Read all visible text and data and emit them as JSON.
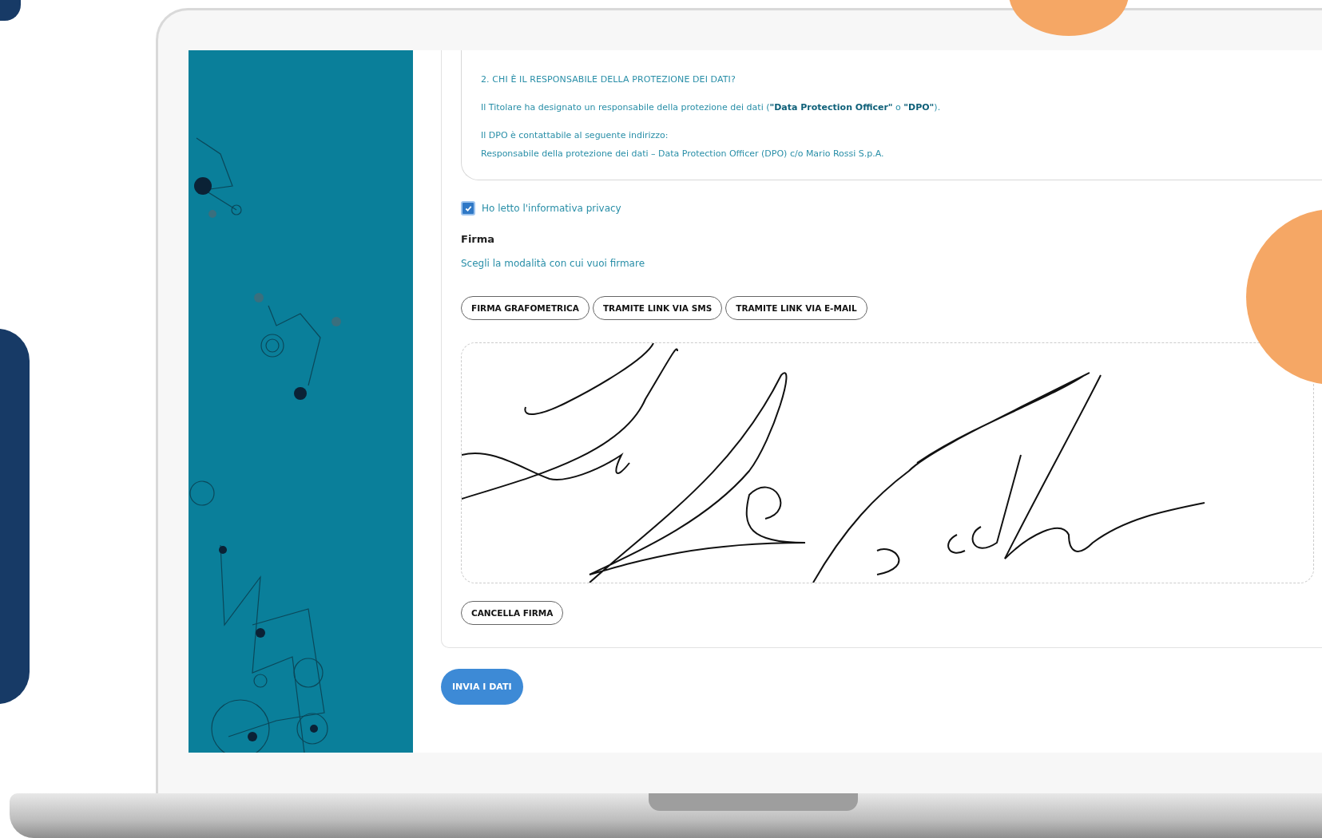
{
  "privacy_info": {
    "heading": "2. CHI È IL RESPONSABILE DELLA PROTEZIONE DEI DATI?",
    "paragraphs": [
      {
        "lines": [
          "Il Titolare ha designato un responsabile della protezione dei dati (**\"Data Protection Officer\"** o **\"DPO\"**)."
        ]
      },
      {
        "lines": [
          "Il DPO è contattabile al seguente indirizzo:",
          "Responsabile della protezione dei dati – Data Protection Officer (DPO) c/o Mario Rossi S.p.A."
        ]
      }
    ]
  },
  "privacy_checkbox": {
    "label": "Ho letto l'informativa privacy",
    "checked": true
  },
  "signature": {
    "title": "Firma",
    "subtitle": "Scegli la modalità con cui vuoi firmare",
    "methods": [
      {
        "label": "FIRMA GRAFOMETRICA"
      },
      {
        "label": "TRAMITE LINK VIA SMS"
      },
      {
        "label": "TRAMITE LINK VIA E-MAIL"
      }
    ],
    "clear_button": "CANCELLA FIRMA"
  },
  "submit_button": "INVIA I DATI"
}
